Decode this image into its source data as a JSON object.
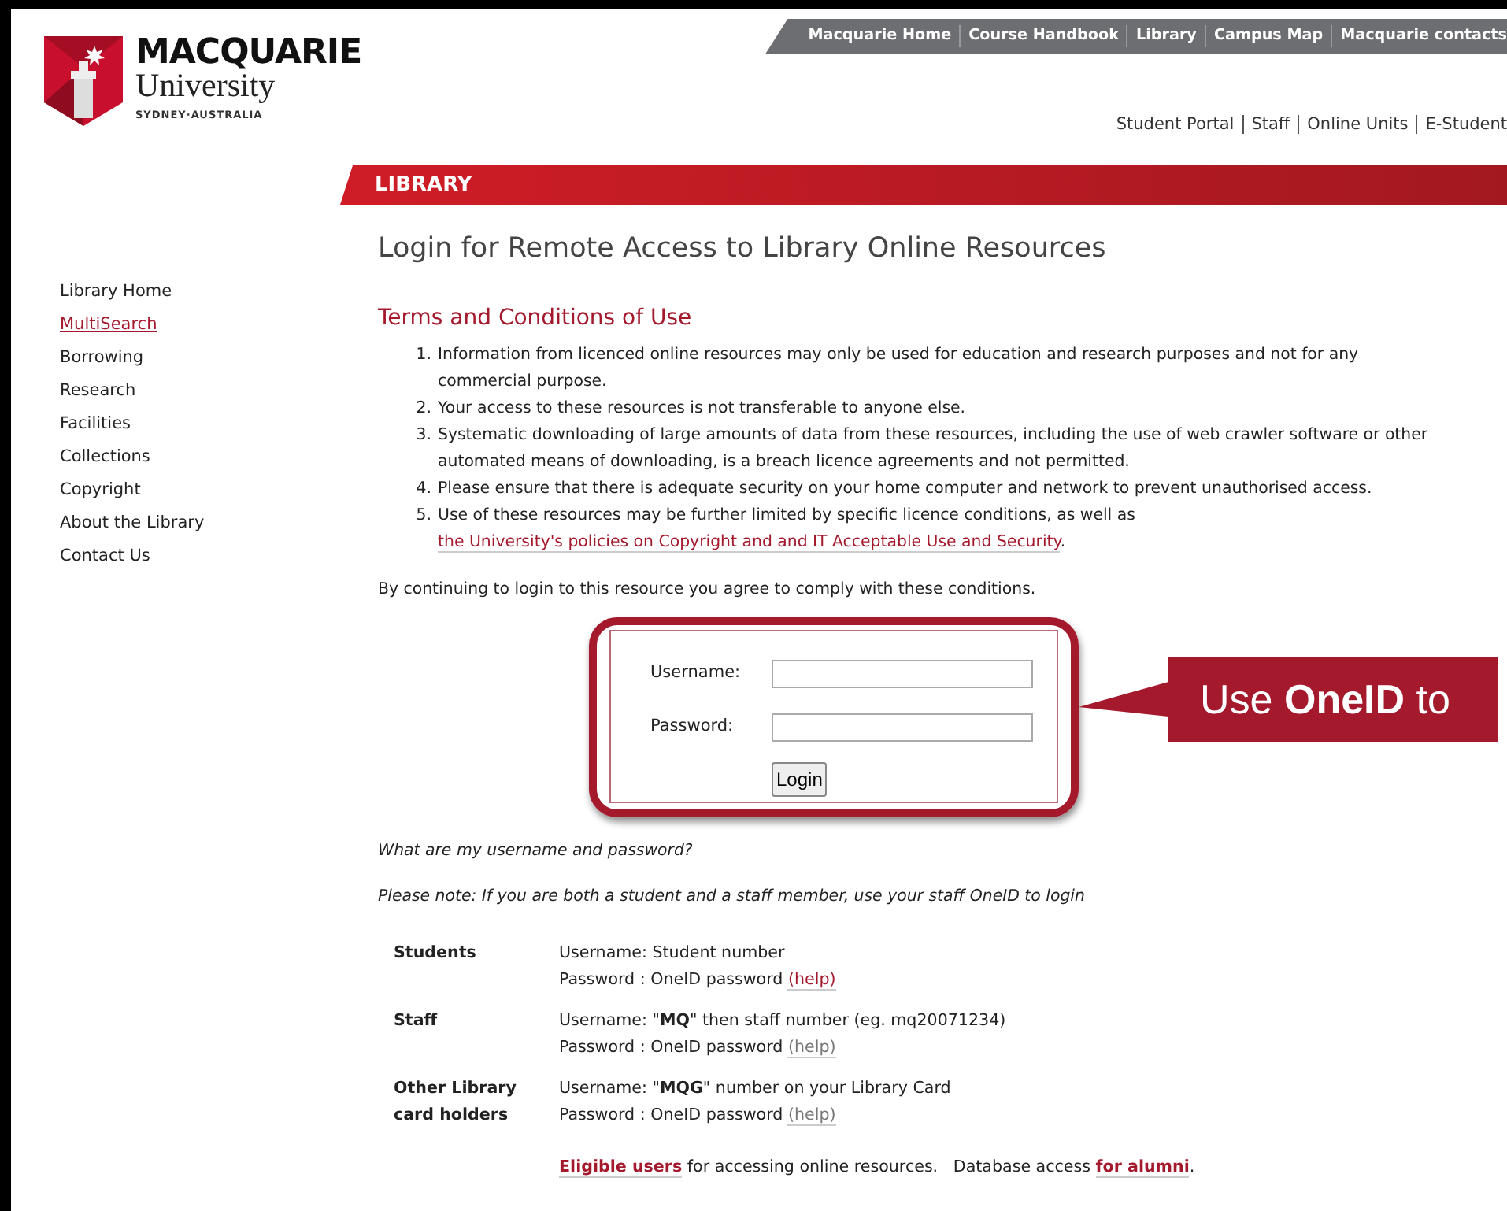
{
  "logo": {
    "name": "MACQUARIE",
    "sub": "University",
    "tagline": "SYDNEY·AUSTRALIA"
  },
  "top_links": [
    "Macquarie Home",
    "Course Handbook",
    "Library",
    "Campus Map",
    "Macquarie contacts"
  ],
  "secondary_links": [
    "Student Portal",
    "Staff",
    "Online Units",
    "E-Student"
  ],
  "section_banner": "LIBRARY",
  "sidebar": {
    "items": [
      {
        "label": "Library Home",
        "selected": false
      },
      {
        "label": "MultiSearch",
        "selected": true
      },
      {
        "label": "Borrowing",
        "selected": false
      },
      {
        "label": "Research",
        "selected": false
      },
      {
        "label": "Facilities",
        "selected": false
      },
      {
        "label": "Collections",
        "selected": false
      },
      {
        "label": "Copyright",
        "selected": false
      },
      {
        "label": "About the Library",
        "selected": false
      },
      {
        "label": "Contact Us",
        "selected": false
      }
    ]
  },
  "page_title": "Login for Remote Access to Library Online Resources",
  "terms": {
    "heading": "Terms and Conditions of Use",
    "items": [
      {
        "number": "1.",
        "text": "Information from licenced online resources may only be used for education and research purposes and not for any commercial purpose."
      },
      {
        "number": "2.",
        "text": "Your access to these resources is not transferable to anyone else."
      },
      {
        "number": "3.",
        "text": "Systematic downloading of large amounts of data from these resources, including the use of web crawler software or other automated means of downloading, is a breach licence agreements and not permitted."
      },
      {
        "number": "4.",
        "text": "Please ensure that there is adequate security on your home computer and network to prevent unauthorised access."
      },
      {
        "number": "5.",
        "text": "Use of these resources may be further limited by specific licence conditions, as well as",
        "link": "the University's policies on Copyright and and IT Acceptable Use and Security",
        "after": "."
      }
    ]
  },
  "agreement": "By continuing to login to this resource you agree to comply with these conditions.",
  "login_form": {
    "fields": [
      {
        "label": "Username:"
      },
      {
        "label": "Password:"
      }
    ],
    "button": "Login"
  },
  "callout": "Use **OneID** to",
  "help_question": "What are my username and password?",
  "note": "Please note: If you are both a student and a staff member, use your staff OneID to login",
  "accounts": [
    {
      "type": "Students",
      "lines": [
        {
          "text": "Username: Student number"
        },
        {
          "text": "Password : OneID password",
          "link": "(help)",
          "visited": false
        }
      ]
    },
    {
      "type": "Staff",
      "lines": [
        {
          "text": "Username: \"**MQ**\" then staff number (eg. mq20071234)"
        },
        {
          "text": "Password : OneID password",
          "link": "(help)",
          "visited": true
        }
      ]
    },
    {
      "type": "Other Library card holders",
      "lines": [
        {
          "text": "Username: \"**MQG**\" number on your Library Card"
        },
        {
          "text": "Password : OneID password",
          "link": "(help)",
          "visited": true
        }
      ]
    }
  ],
  "footer": [
    {
      "kind": "link",
      "text": "Eligible users"
    },
    {
      "kind": "text",
      "text": " for accessing online resources.   Database access "
    },
    {
      "kind": "link",
      "text": "for alumni"
    },
    {
      "kind": "text",
      "text": "."
    }
  ]
}
